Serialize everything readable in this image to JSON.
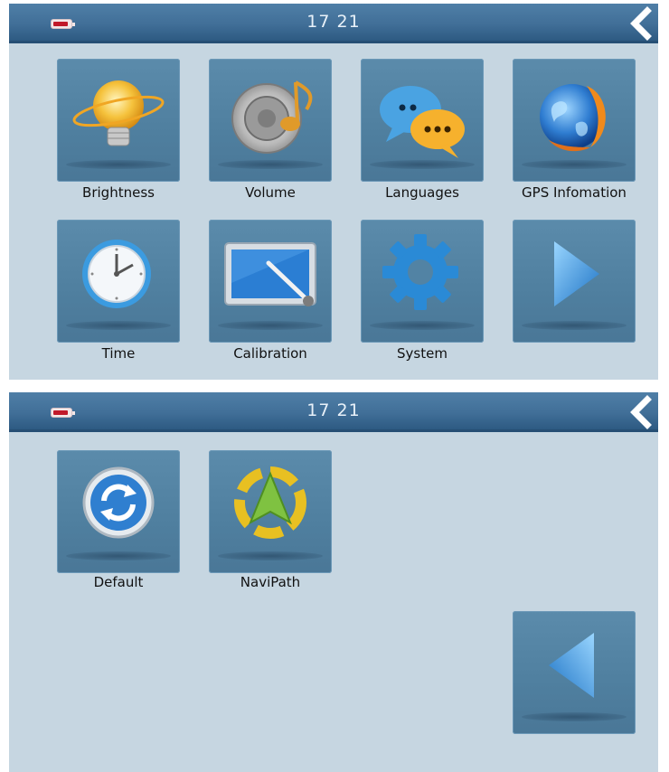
{
  "screen1": {
    "time": "17 21",
    "items": [
      {
        "label": "Brightness"
      },
      {
        "label": "Volume"
      },
      {
        "label": "Languages"
      },
      {
        "label": "GPS Infomation"
      },
      {
        "label": "Time"
      },
      {
        "label": "Calibration"
      },
      {
        "label": "System"
      }
    ]
  },
  "screen2": {
    "time": "17 21",
    "items": [
      {
        "label": "Default"
      },
      {
        "label": "NaviPath"
      }
    ]
  },
  "icons": {
    "battery": "battery-icon",
    "back": "back-chevron-icon",
    "next": "next-arrow-icon",
    "prev": "prev-arrow-icon"
  },
  "colors": {
    "screen_bg": "#c6d6e1",
    "topbar": "#416f98",
    "tile": "#5283a4",
    "battery_fill": "#c1192a"
  }
}
